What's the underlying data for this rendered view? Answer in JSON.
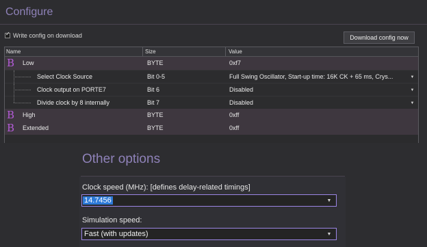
{
  "configure": {
    "title": "Configure"
  },
  "write_config": {
    "label": "Write config on download",
    "checked": true
  },
  "download_button": {
    "label": "Download config now"
  },
  "fuse_table": {
    "headers": [
      "Name",
      "Size",
      "Value"
    ],
    "rows": [
      {
        "type": "group",
        "icon": "B",
        "name": "Low",
        "size": "BYTE",
        "value": "0xf7"
      },
      {
        "type": "child",
        "name": "Select Clock Source",
        "size": "Bit 0-5",
        "value": "Full Swing Oscillator, Start-up time: 16K CK + 65 ms, Crys...",
        "dropdown": true
      },
      {
        "type": "child",
        "name": "Clock output on PORTE7",
        "size": "Bit 6",
        "value": "Disabled",
        "dropdown": true
      },
      {
        "type": "child",
        "name": "Divide clock by 8 internally",
        "size": "Bit 7",
        "value": "Disabled",
        "dropdown": true
      },
      {
        "type": "group",
        "icon": "B",
        "name": "High",
        "size": "BYTE",
        "value": "0xff"
      },
      {
        "type": "group",
        "icon": "B",
        "name": "Extended",
        "size": "BYTE",
        "value": "0xff"
      }
    ]
  },
  "other_options": {
    "title": "Other options",
    "clock_speed": {
      "label": "Clock speed (MHz): [defines delay-related timings]",
      "value": "14.7456"
    },
    "simulation_speed": {
      "label": "Simulation speed:",
      "value": "Fast (with updates)"
    }
  },
  "colors": {
    "accent": "#8f82b9",
    "selection": "#2d7ad8",
    "focus_border": "#9c86e6",
    "group_row": "#3e373f",
    "fuse_icon": "#b45bd8"
  },
  "icons": {
    "checkbox": "check-icon",
    "fuse_group": "fuse-byte-icon",
    "dropdown": "chevron-down-icon"
  }
}
